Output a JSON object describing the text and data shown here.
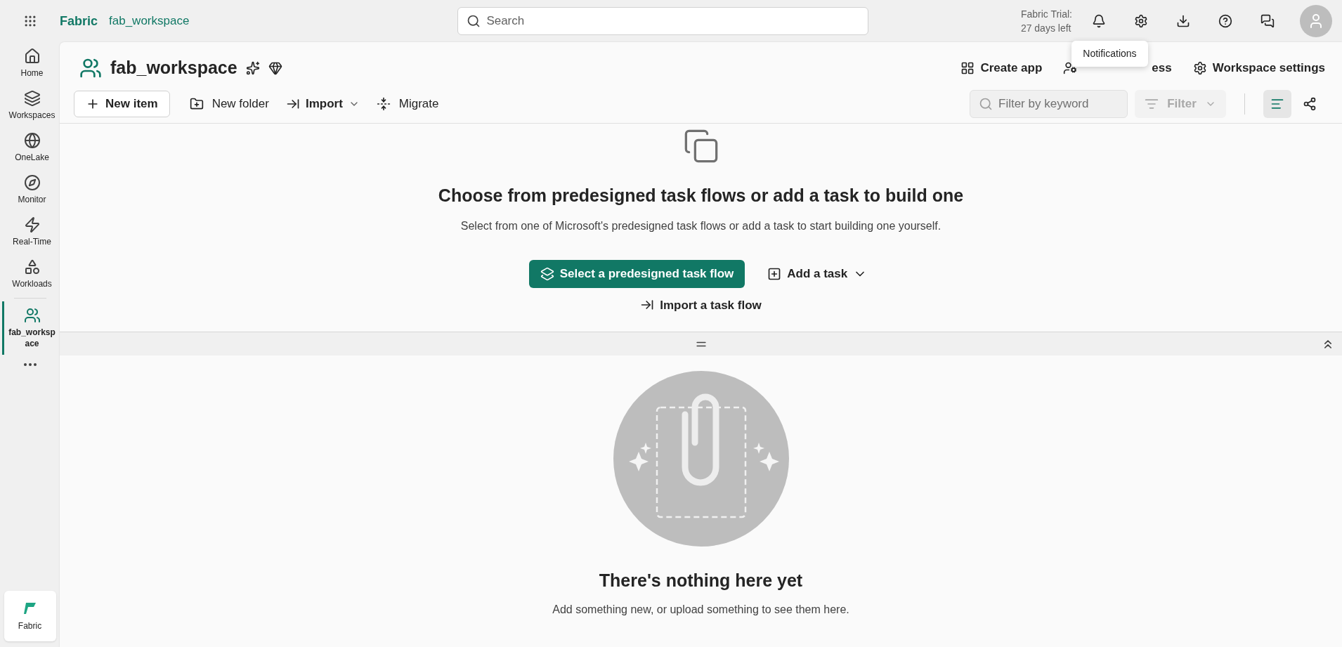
{
  "top_bar": {
    "brand": "Fabric",
    "breadcrumb": "fab_workspace",
    "search": {
      "placeholder": "Search"
    },
    "trial_line_1": "Fabric Trial:",
    "trial_line_2": "27 days left"
  },
  "tooltip": "Notifications",
  "sidebar": {
    "items": [
      {
        "label": "Home",
        "selected": false
      },
      {
        "label": "Workspaces",
        "selected": false
      },
      {
        "label": "OneLake",
        "selected": false
      },
      {
        "label": "Monitor",
        "selected": false
      },
      {
        "label": "Real-Time",
        "selected": false
      },
      {
        "label": "Workloads",
        "selected": false
      },
      {
        "label": "fab_workspace",
        "selected": true
      }
    ],
    "footer": "Fabric"
  },
  "workspace": {
    "title": "fab_workspace",
    "actions": [
      {
        "label": "Create app"
      },
      {
        "label": "ess"
      },
      {
        "label": "Workspace settings"
      }
    ]
  },
  "toolbar": {
    "buttons": [
      {
        "kind": "primary",
        "label": "New item"
      },
      {
        "kind": "plain",
        "label": "New folder"
      },
      {
        "kind": "dropdown",
        "label": "Import"
      },
      {
        "kind": "plain",
        "label": "Migrate"
      }
    ],
    "filter_field": {
      "placeholder": "Filter by keyword"
    },
    "filter_button": {
      "label": "Filter",
      "disabled": true
    },
    "views": [
      {
        "selected": true
      },
      {
        "selected": false
      }
    ]
  },
  "task_flow": {
    "heading": "Choose from predesigned task flows or add a task to build one",
    "description": "Select from one of Microsoft's predesigned task flows or add a task to start building one yourself.",
    "primary_button": "Select a predesigned task flow",
    "add_button": "Add a task",
    "import_link": "Import a task flow"
  },
  "empty_state": {
    "heading": "There's nothing here yet",
    "description": "Add something new, or upload something to see them here."
  }
}
